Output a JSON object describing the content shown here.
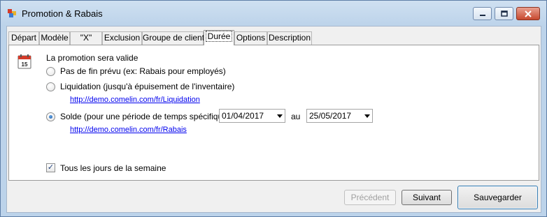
{
  "window": {
    "title": "Promotion & Rabais"
  },
  "tabs": [
    {
      "label": "Départ"
    },
    {
      "label": "Modèle"
    },
    {
      "label": "\"X\""
    },
    {
      "label": "Exclusion"
    },
    {
      "label": "Groupe de client"
    },
    {
      "label": "Durée",
      "active": true
    },
    {
      "label": "Options"
    },
    {
      "label": "Description"
    }
  ],
  "duration": {
    "heading": "La promotion sera valide",
    "options": [
      {
        "label": "Pas de fin prévu (ex: Rabais pour employés)",
        "selected": false
      },
      {
        "label": "Liquidation (jusqu'à épuisement de l'inventaire)",
        "selected": false,
        "link": "http://demo.comelin.com/fr/Liquidation"
      },
      {
        "label": "Solde (pour une période de temps spécifique)",
        "selected": true,
        "link": "http://demo.comelin.com/fr/Rabais"
      }
    ],
    "start_date": "01/04/2017",
    "to_label": "au",
    "end_date": "25/05/2017",
    "all_week_label": "Tous les jours de la semaine",
    "all_week_checked": true
  },
  "footer": {
    "prev_label": "Précédent",
    "next_label": "Suivant",
    "save_label": "Sauvegarder"
  },
  "icons": {
    "app": "app-icon",
    "calendar": "calendar-icon",
    "minimize": "minimize-icon",
    "maximize": "maximize-icon",
    "close": "close-icon"
  },
  "colors": {
    "link": "#0000ee",
    "titlebar": "#bcd3ea",
    "close": "#c7492f"
  }
}
